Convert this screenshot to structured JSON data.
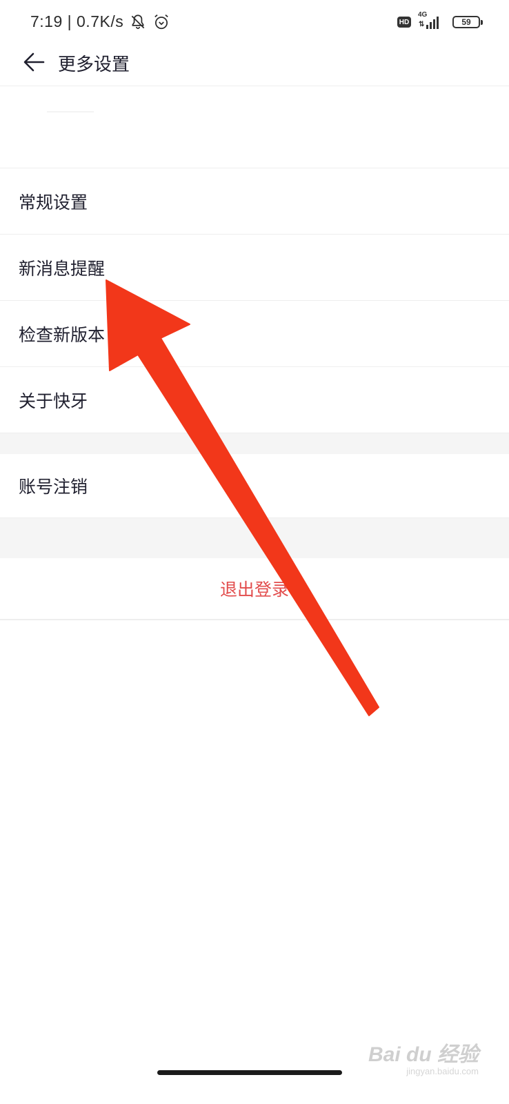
{
  "status_bar": {
    "time_speed": "7:19 | 0.7K/s",
    "hd": "HD",
    "network": "4G",
    "network_arrows": "⇅",
    "battery": "59"
  },
  "header": {
    "title": "更多设置"
  },
  "settings": {
    "items": [
      {
        "label": "常规设置"
      },
      {
        "label": "新消息提醒"
      },
      {
        "label": "检查新版本"
      },
      {
        "label": "关于快牙"
      }
    ],
    "account_cancel": "账号注销",
    "logout": "退出登录"
  },
  "colors": {
    "annotation_arrow": "#f2371a",
    "logout_text": "#e24c4c",
    "section_gap": "#f5f5f5"
  },
  "watermark": {
    "main": "Bai du 经验",
    "sub": "jingyan.baidu.com"
  }
}
